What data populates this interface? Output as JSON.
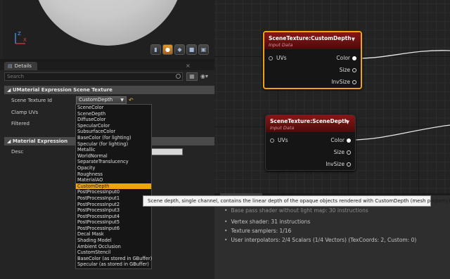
{
  "viewport": {
    "axis_z": "Z",
    "axis_x": "X"
  },
  "details": {
    "tab_label": "Details",
    "close_glyph": "×",
    "search_placeholder": "Search",
    "section_scene_texture": "UMaterial Expression Scene Texture",
    "scene_texture_id_label": "Scene Texture Id",
    "scene_texture_id_value": "CustomDepth",
    "clamp_uvs_label": "Clamp UVs",
    "filtered_label": "Filtered",
    "section_material_expression": "Material Expression",
    "desc_label": "Desc",
    "dropdown_options": [
      "SceneColor",
      "SceneDepth",
      "DiffuseColor",
      "SpecularColor",
      "SubsurfaceColor",
      "BaseColor (for lighting)",
      "Specular (for lighting)",
      "Metallic",
      "WorldNormal",
      "SeparateTranslucency",
      "Opacity",
      "Roughness",
      "MaterialAO",
      "CustomDepth",
      "PostProcessInput0",
      "PostProcessInput1",
      "PostProcessInput2",
      "PostProcessInput3",
      "PostProcessInput4",
      "PostProcessInput5",
      "PostProcessInput6",
      "Decal Mask",
      "Shading Model",
      "Ambient Occlusion",
      "CustomStencil",
      "BaseColor (as stored in GBuffer)",
      "Specular (as stored in GBuffer)"
    ],
    "highlighted_option": "CustomDepth",
    "tooltip": "Scene depth, single channel, contains the linear depth of the opaque objects rendered with CustomDepth (mesh property)"
  },
  "graph": {
    "node1": {
      "title": "SceneTexture:CustomDepth",
      "subtitle": "Input Data",
      "input": "UVs",
      "outputs": [
        "Color",
        "Size",
        "InvSize"
      ]
    },
    "node2": {
      "title": "SceneTexture:SceneDepth",
      "subtitle": "Input Data",
      "input": "UVs",
      "outputs": [
        "Color",
        "Size",
        "InvSize"
      ]
    }
  },
  "stats": {
    "lines": [
      "Base pass shader without light map: 30 instructions",
      "Vertex shader: 31 instructions",
      "Texture samplers: 1/16",
      "User interpolators: 2/4 Scalars (1/4 Vectors) (TexCoords: 2, Custom: 0)"
    ]
  },
  "colors": {
    "accent": "#f0a30a",
    "node_header": "#8a1515",
    "tooltip_bg": "#f3f3f3"
  }
}
